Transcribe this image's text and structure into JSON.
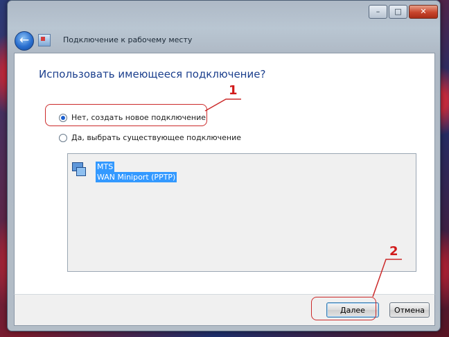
{
  "window": {
    "title": "Подключение к рабочему месту",
    "controls": {
      "minimize": "–",
      "maximize": "□",
      "close": "✕"
    }
  },
  "page": {
    "headline": "Использовать имеющееся подключение?",
    "options": [
      {
        "label": "Нет, создать новое подключение",
        "selected": true
      },
      {
        "label": "Да, выбрать существующее подключение",
        "selected": false
      }
    ],
    "connection": {
      "name": "MTS",
      "device": "WAN Miniport (PPTP)"
    }
  },
  "buttons": {
    "next": "Далее",
    "cancel": "Отмена"
  },
  "annotations": {
    "one": "1",
    "two": "2",
    "color": "#cc2a2a"
  },
  "icons": [
    "back-arrow-icon",
    "vpn-app-icon",
    "network-connection-icon",
    "minimize-icon",
    "maximize-icon",
    "close-icon"
  ]
}
